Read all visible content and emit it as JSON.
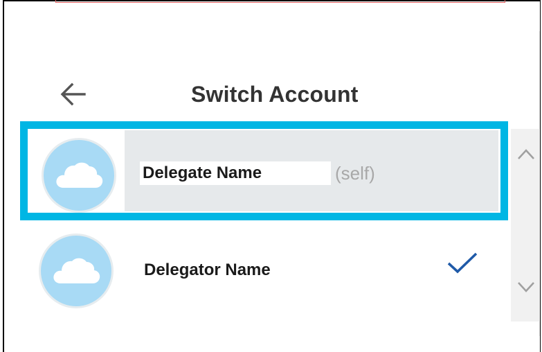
{
  "header": {
    "title": "Switch Account",
    "back_icon": "arrow-left-icon"
  },
  "accounts": [
    {
      "name": "Delegate Name",
      "tag": "(self)",
      "avatar_icon": "cloud-icon",
      "highlighted": true,
      "selected": false
    },
    {
      "name": "Delegator Name",
      "tag": "",
      "avatar_icon": "cloud-icon",
      "highlighted": false,
      "selected": true
    }
  ],
  "scrollbar": {
    "up_icon": "chevron-up-icon",
    "down_icon": "chevron-down-icon"
  },
  "colors": {
    "highlight_border": "#00b6e4",
    "row_highlight_bg": "#e6e9eb",
    "avatar_bg": "#a8daf5",
    "check": "#1f5aa8",
    "self_tag": "#a8a8a8"
  }
}
